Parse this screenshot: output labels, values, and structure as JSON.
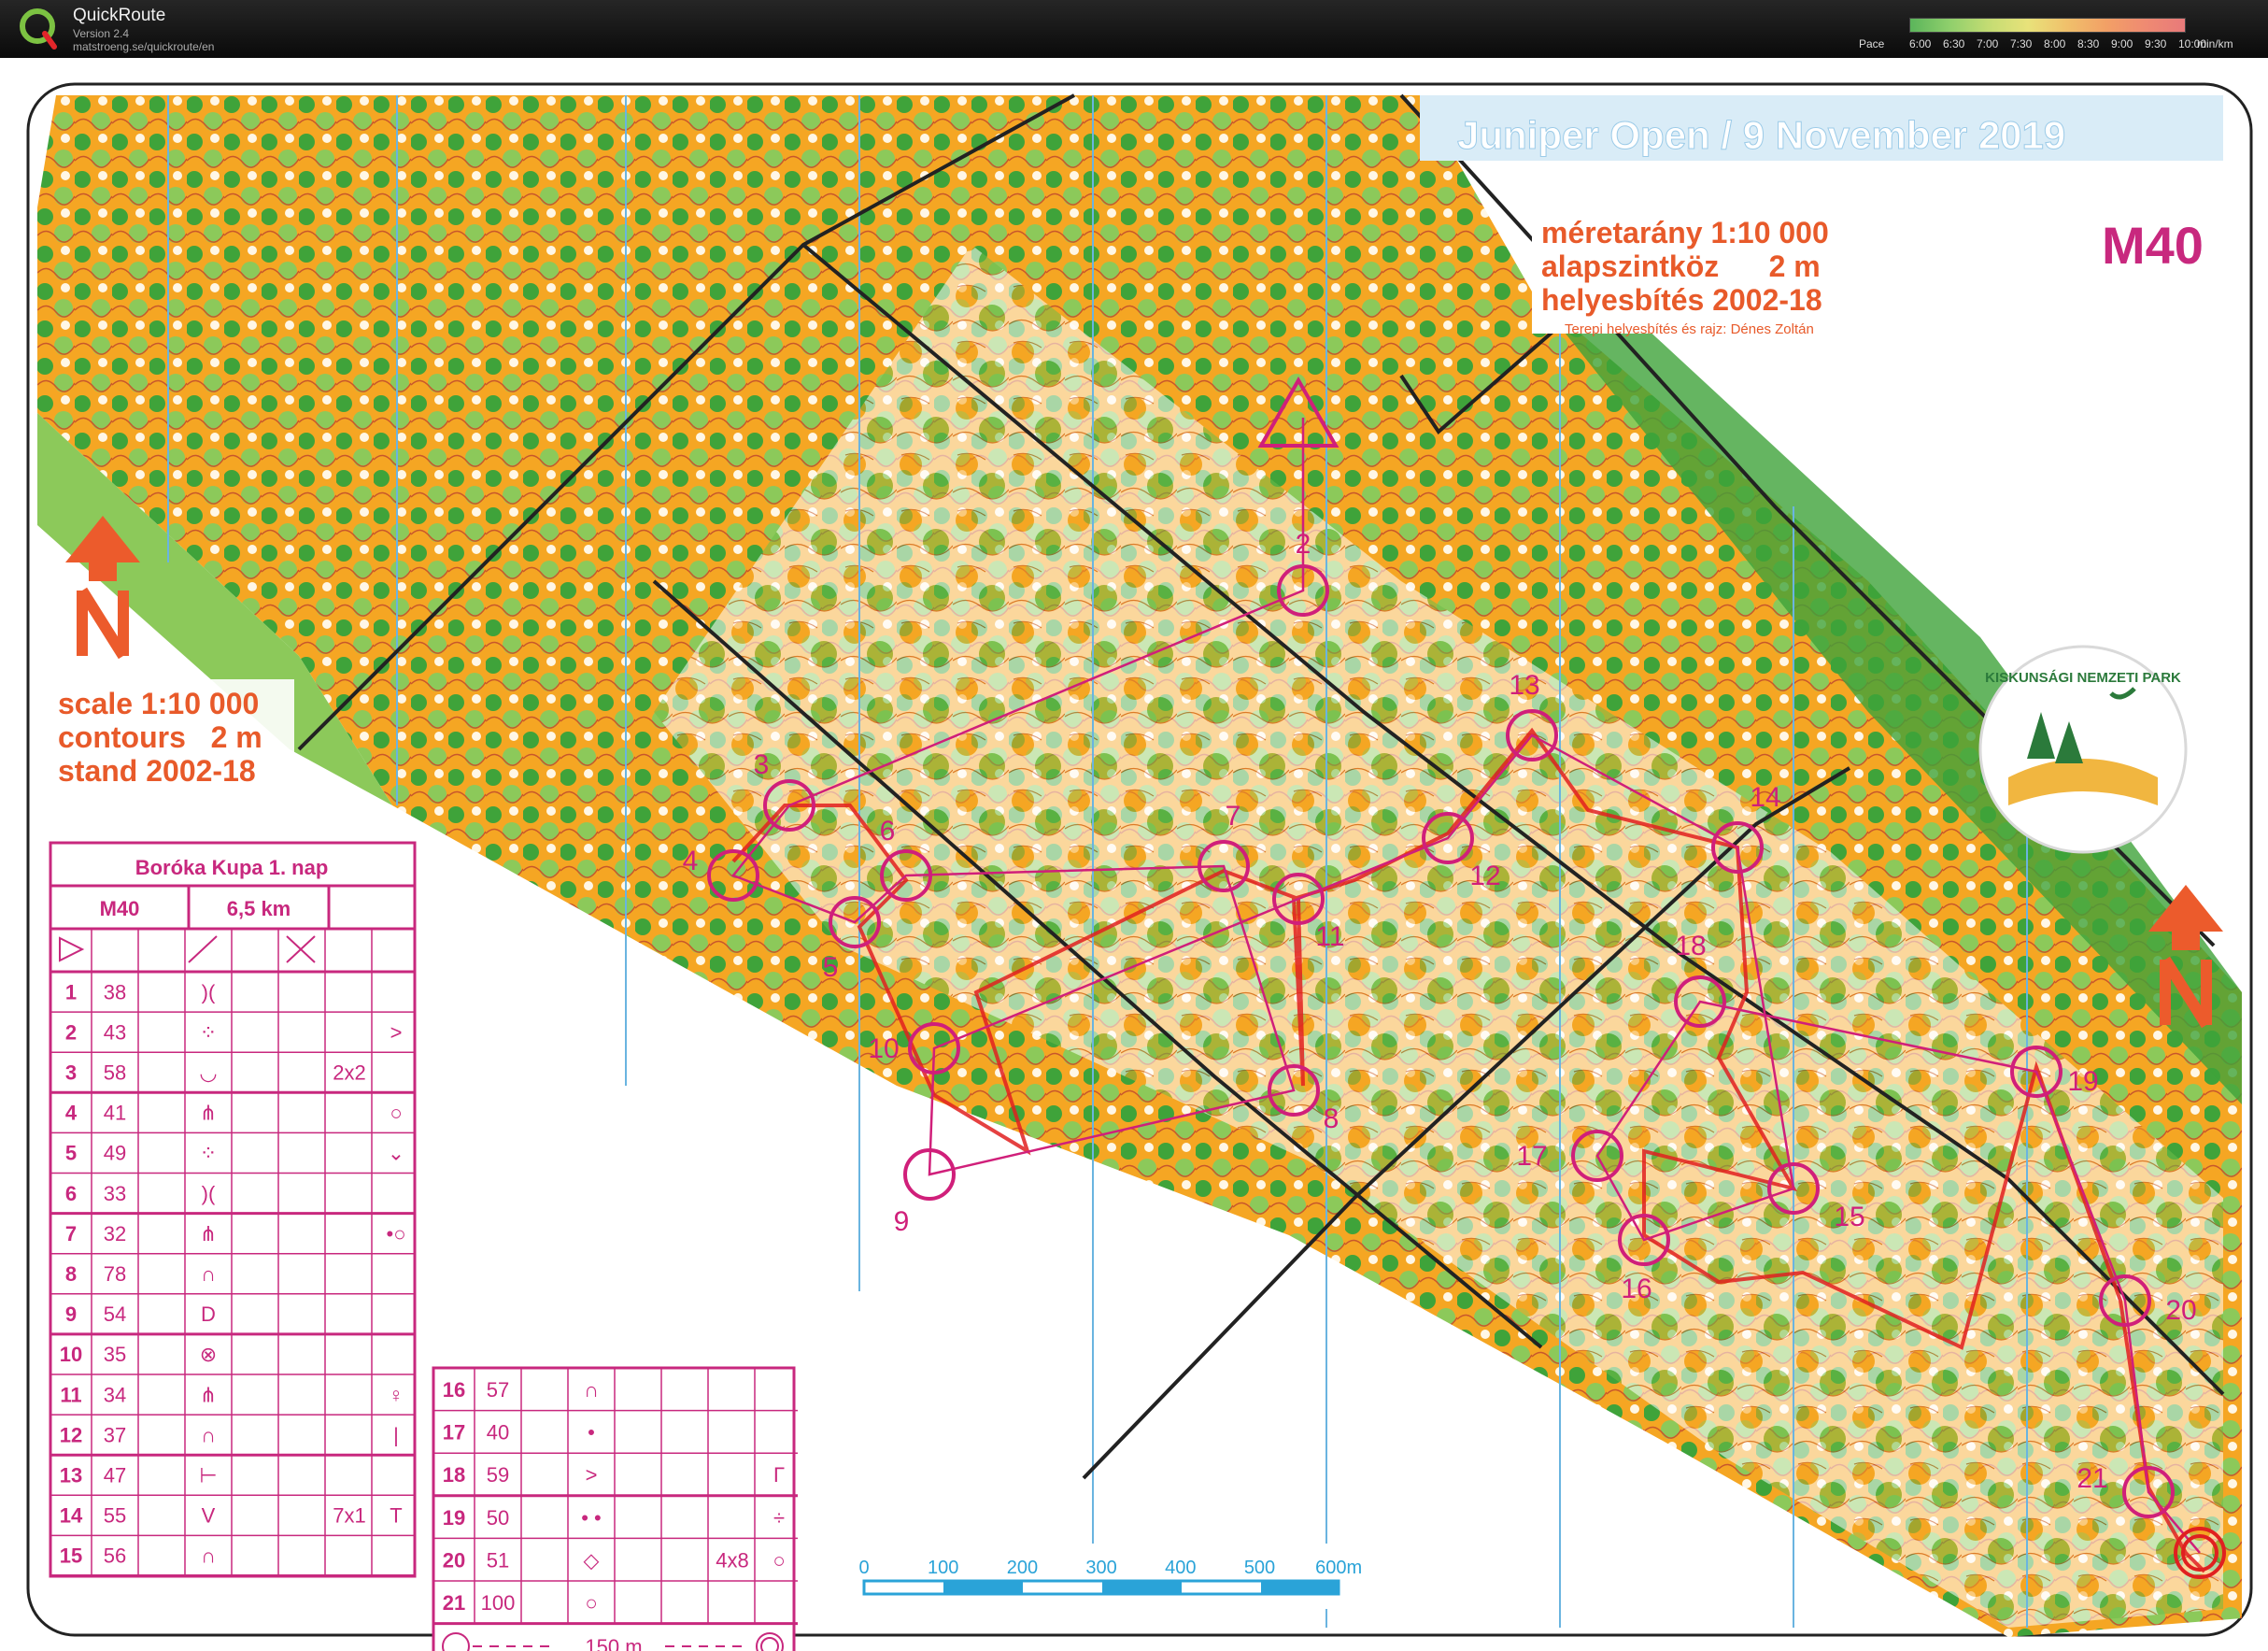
{
  "app": {
    "name": "QuickRoute",
    "version": "Version 2.4",
    "url": "matstroeng.se/quickroute/en"
  },
  "pace_legend": {
    "label": "Pace",
    "ticks": [
      "6:00",
      "6:30",
      "7:00",
      "7:30",
      "8:00",
      "8:30",
      "9:00",
      "9:30",
      "10:00"
    ],
    "unit": "min/km",
    "colors": [
      "#5bb55b",
      "#8fcf6c",
      "#c4dc73",
      "#e8e27a",
      "#f0c06b",
      "#f2a066",
      "#ef8a72",
      "#e87a7a"
    ]
  },
  "map": {
    "title": "Juniper Open   /  9 November 2019",
    "category": "M40",
    "info_hu": [
      "méretarány 1:10 000",
      "alapszintköz      2 m",
      "helyesbítés  2002-18"
    ],
    "credit": "Terepi helyesbítés és rajz: Dénes Zoltán",
    "info_en": [
      "scale 1:10 000",
      "contours   2 m",
      "stand  2002-18"
    ],
    "park_logo_text": "KISKUNSÁGI NEMZETI PARK",
    "scale_bar": {
      "ticks": [
        "0",
        "100",
        "200",
        "300",
        "400",
        "500",
        "600m"
      ]
    },
    "control_labels": [
      "2",
      "3",
      "4",
      "5",
      "6",
      "7",
      "8",
      "9",
      "10",
      "11",
      "12",
      "13",
      "14",
      "15",
      "16",
      "17",
      "18",
      "19",
      "20",
      "21"
    ],
    "colors": {
      "forest_green": "#3fa33a",
      "light_green": "#8cc95a",
      "open_yellow": "#f5a623",
      "contour_brown": "#c8572b",
      "course_magenta": "#d01f7a",
      "route_red": "#e02020",
      "title_bg": "#d9ecf7",
      "title_text": "#ffffff",
      "north_orange": "#ec5b2c"
    }
  },
  "description_sheet": {
    "event": "Boróka Kupa 1. nap",
    "class": "M40",
    "length": "6,5 km",
    "rows_left": [
      {
        "num": "1",
        "code": "38",
        "sym": ")(",
        "size": "",
        "extra": ""
      },
      {
        "num": "2",
        "code": "43",
        "sym": "⁘",
        "size": "",
        "extra": ">"
      },
      {
        "num": "3",
        "code": "58",
        "sym": "◡",
        "size": "2x2",
        "extra": ""
      },
      {
        "num": "4",
        "code": "41",
        "sym": "⋔",
        "size": "",
        "extra": "○"
      },
      {
        "num": "5",
        "code": "49",
        "sym": "⁘",
        "size": "",
        "extra": "⌄"
      },
      {
        "num": "6",
        "code": "33",
        "sym": ")(",
        "size": "",
        "extra": ""
      },
      {
        "num": "7",
        "code": "32",
        "sym": "⋔",
        "size": "",
        "extra": "•○"
      },
      {
        "num": "8",
        "code": "78",
        "sym": "∩",
        "size": "",
        "extra": ""
      },
      {
        "num": "9",
        "code": "54",
        "sym": "D",
        "size": "",
        "extra": ""
      },
      {
        "num": "10",
        "code": "35",
        "sym": "⊗",
        "size": "",
        "extra": ""
      },
      {
        "num": "11",
        "code": "34",
        "sym": "⋔",
        "size": "",
        "extra": "♀"
      },
      {
        "num": "12",
        "code": "37",
        "sym": "∩",
        "size": "",
        "extra": "|"
      },
      {
        "num": "13",
        "code": "47",
        "sym": "⊢",
        "size": "",
        "extra": ""
      },
      {
        "num": "14",
        "code": "55",
        "sym": "V",
        "size": "7x1",
        "extra": "T"
      },
      {
        "num": "15",
        "code": "56",
        "sym": "∩",
        "size": "",
        "extra": ""
      }
    ],
    "rows_right": [
      {
        "num": "16",
        "code": "57",
        "sym": "∩",
        "size": "",
        "extra": ""
      },
      {
        "num": "17",
        "code": "40",
        "sym": "•",
        "size": "",
        "extra": ""
      },
      {
        "num": "18",
        "code": "59",
        "sym": ">",
        "size": "",
        "extra": "Γ"
      },
      {
        "num": "19",
        "code": "50",
        "sym": "• •",
        "size": "",
        "extra": "÷"
      },
      {
        "num": "20",
        "code": "51",
        "sym": "◇",
        "size": "4x8",
        "extra": "○"
      },
      {
        "num": "21",
        "code": "100",
        "sym": "○",
        "size": "",
        "extra": ""
      }
    ],
    "finish_text": "150 m"
  }
}
